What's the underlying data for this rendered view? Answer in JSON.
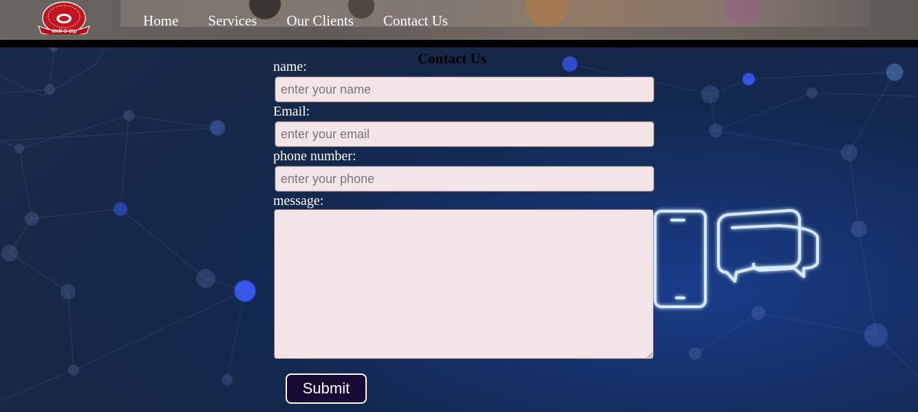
{
  "header": {
    "logo_text": "Well O Sip",
    "nav": [
      {
        "label": "Home"
      },
      {
        "label": "Services"
      },
      {
        "label": "Our Clients"
      },
      {
        "label": "Contact Us"
      }
    ]
  },
  "main": {
    "title": "Contact Us",
    "form": {
      "name_label": "name:",
      "name_placeholder": "enter your name",
      "email_label": "Email:",
      "email_placeholder": "enter your email",
      "phone_label": "phone number:",
      "phone_placeholder": "enter your phone",
      "message_label": "message:",
      "submit_label": "Submit"
    }
  },
  "icons": {
    "logo": "well-o-sip-logo",
    "phone": "smartphone-icon",
    "chat": "chat-bubbles-icon"
  },
  "colors": {
    "background": "#172744",
    "field": "#f3e4e8",
    "button": "#160b35",
    "neon": "#d7ebff"
  }
}
